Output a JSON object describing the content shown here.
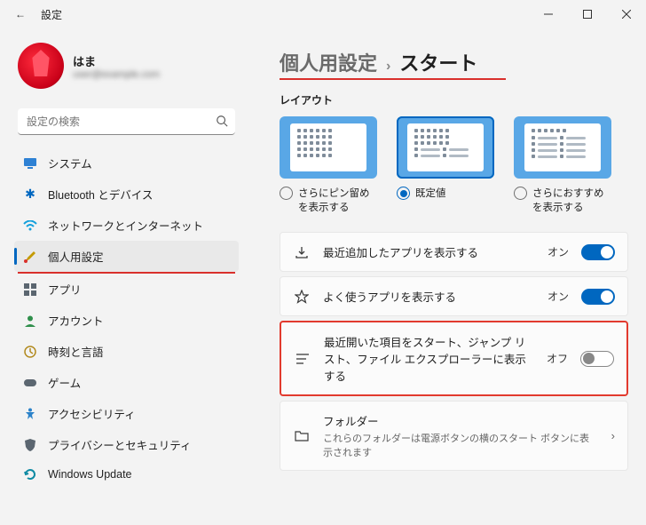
{
  "window": {
    "title": "設定",
    "back_icon": "←"
  },
  "profile": {
    "username": "はま",
    "email": "user@example.com"
  },
  "search": {
    "placeholder": "設定の検索"
  },
  "sidebar": {
    "items": [
      {
        "label": "システム",
        "icon_color": "#0067c0"
      },
      {
        "label": "Bluetooth とデバイス",
        "icon_color": "#0067c0"
      },
      {
        "label": "ネットワークとインターネット",
        "icon_color": "#0aa3d8"
      },
      {
        "label": "個人用設定",
        "icon_color": "#c49a00",
        "active": true
      },
      {
        "label": "アプリ",
        "icon_color": "#5b6670"
      },
      {
        "label": "アカウント",
        "icon_color": "#2f8f4b"
      },
      {
        "label": "時刻と言語",
        "icon_color": "#b28a1f"
      },
      {
        "label": "ゲーム",
        "icon_color": "#5b6670"
      },
      {
        "label": "アクセシビリティ",
        "icon_color": "#2b82c9"
      },
      {
        "label": "プライバシーとセキュリティ",
        "icon_color": "#5b6670"
      },
      {
        "label": "Windows Update",
        "icon_color": "#0e8aa3"
      }
    ]
  },
  "breadcrumb": {
    "parent": "個人用設定",
    "sep": "›",
    "current": "スタート"
  },
  "layout": {
    "section_label": "レイアウト",
    "options": [
      {
        "label": "さらにピン留めを表示する",
        "selected": false,
        "variant": "more"
      },
      {
        "label": "既定値",
        "selected": true,
        "variant": "default"
      },
      {
        "label": "さらにおすすめを表示する",
        "selected": false,
        "variant": "reco"
      }
    ]
  },
  "settings": [
    {
      "icon": "download",
      "title": "最近追加したアプリを表示する",
      "state": "オン",
      "toggle": "on"
    },
    {
      "icon": "star",
      "title": "よく使うアプリを表示する",
      "state": "オン",
      "toggle": "on"
    },
    {
      "icon": "list",
      "title": "最近開いた項目をスタート、ジャンプ リスト、ファイル エクスプローラーに表示する",
      "state": "オフ",
      "toggle": "off",
      "highlight": true
    },
    {
      "icon": "folder",
      "title": "フォルダー",
      "subtitle": "これらのフォルダーは電源ボタンの横のスタート ボタンに表示されます",
      "chevron": true
    }
  ]
}
